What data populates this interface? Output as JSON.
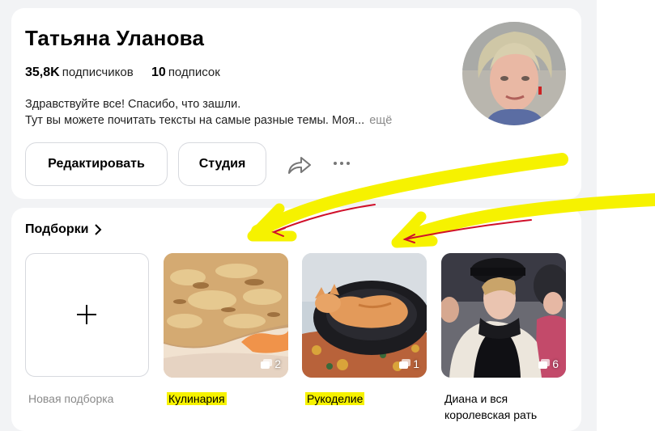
{
  "profile": {
    "name": "Татьяна Уланова",
    "subscribers_count": "35,8K",
    "subscribers_label": "подписчиков",
    "subscriptions_count": "10",
    "subscriptions_label": "подписок",
    "bio_line1": "Здравствуйте все! Спасибо, что зашли.",
    "bio_line2": "Тут вы можете почитать тексты на самые разные темы. Моя...",
    "more_label": "ещё",
    "buttons": {
      "edit": "Редактировать",
      "studio": "Студия"
    },
    "icons": [
      "share-icon",
      "more-dots-icon"
    ]
  },
  "collections": {
    "title": "Подборки",
    "new_label": "Новая подборка",
    "items": [
      {
        "label": "Кулинария",
        "count": "2",
        "highlighted": true
      },
      {
        "label": "Рукоделие",
        "count": "1",
        "highlighted": true
      },
      {
        "label": "Диана и вся королевская рать",
        "count": "6",
        "highlighted": false
      }
    ]
  },
  "colors": {
    "highlight": "#f6f200",
    "arrow_red": "#d0102a",
    "border": "#d7d9de",
    "muted": "#8a8a8a"
  }
}
